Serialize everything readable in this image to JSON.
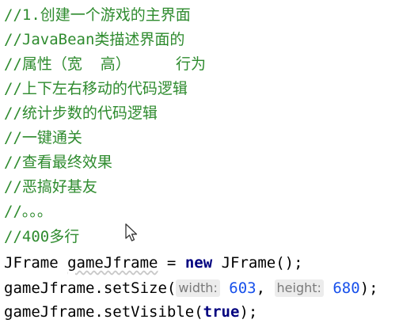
{
  "comments": [
    "//1.创建一个游戏的主界面",
    "//JavaBean类描述界面的",
    "//属性（宽  高）     行为",
    "//上下左右移动的代码逻辑",
    "//统计步数的代码逻辑",
    "//一键通关",
    "//查看最终效果",
    "//恶搞好基友",
    "//。。。",
    "//400多行"
  ],
  "code": {
    "line1": {
      "type": "JFrame",
      "var": "gameJframe",
      "eq": " = ",
      "kw_new": "new",
      "ctor": " JFrame();"
    },
    "line2": {
      "call": "gameJframe.setSize(",
      "hint_width": "width:",
      "width_value": "603",
      "comma": ", ",
      "hint_height": "height:",
      "height_value": "680",
      "end": ");"
    },
    "line3": {
      "call": "gameJframe.setVisible(",
      "kw_true": "true",
      "end": ");"
    }
  },
  "colors": {
    "comment": "#2e8b2e",
    "keyword": "#00007f",
    "number": "#1750eb",
    "hint_bg": "#ececec"
  },
  "cursor_icon": "mouse-pointer-icon"
}
